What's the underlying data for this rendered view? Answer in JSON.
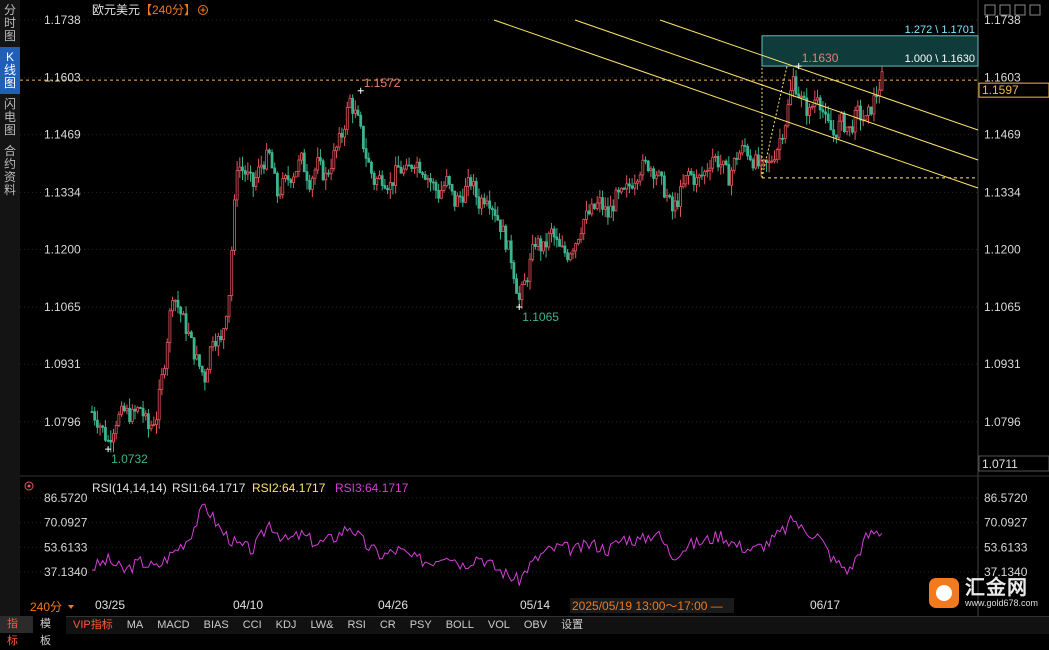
{
  "sidebar": {
    "tabs": [
      {
        "label": [
          "分",
          "时",
          "图"
        ],
        "active": false
      },
      {
        "label": [
          "K",
          "线",
          "图"
        ],
        "active": true
      },
      {
        "label": [
          "闪",
          "电",
          "图"
        ],
        "active": false
      },
      {
        "label": [
          "合",
          "约",
          "资",
          "料"
        ],
        "active": false
      }
    ]
  },
  "header": {
    "title": "欧元美元",
    "period": "【240分】",
    "settings_icon": "circle-plus-icon"
  },
  "toolbar_icons": [
    "move-icon",
    "zoom-out-icon",
    "zoom-in-icon",
    "fullscreen-icon"
  ],
  "colors": {
    "up": "#e9545b",
    "down": "#3bb58f",
    "rsi": "#d43fd8",
    "fib": "#ffe56a",
    "pivot_high": "#f07a7a",
    "pivot_low": "#3bb58f",
    "price_line": "#f4b44c"
  },
  "price_axis": [
    "1.1738",
    "1.1603",
    "1.1469",
    "1.1334",
    "1.1200",
    "1.1065",
    "1.0931",
    "1.0796"
  ],
  "current_price_tag": "1.1597",
  "low_price_tag": "1.0711",
  "annotations": {
    "high1": "1.1572",
    "low1": "1.0732",
    "low2": "1.1065",
    "high2": "1.1630",
    "fib_100": "1.000 \\ 1.1630",
    "fib_1272": "1.272 \\ 1.1701"
  },
  "rsi": {
    "header_label": "RSI(14,14,14)",
    "rsi1": "RSI1:64.1717",
    "rsi2": "RSI2:64.1717",
    "rsi3": "RSI3:64.1717",
    "axis": [
      "86.5720",
      "70.0927",
      "53.6133",
      "37.1340"
    ],
    "icon": "indicator-dot-icon"
  },
  "time_axis": [
    "03/25",
    "04/10",
    "04/26",
    "05/14",
    "06/17"
  ],
  "crosshair_time": "2025/05/19 13:00～17:00",
  "period_label": "240分",
  "bottom_left": [
    "指标",
    "模板"
  ],
  "bottom_tabs": [
    "VIP指标",
    "MA",
    "MACD",
    "BIAS",
    "CCI",
    "KDJ",
    "LW&",
    "RSI",
    "CR",
    "PSY",
    "BOLL",
    "VOL",
    "OBV",
    "设置"
  ],
  "logo": {
    "name": "汇金网",
    "url": "www.gold678.com"
  },
  "chart_data": {
    "type": "candlestick",
    "symbol": "EUR/USD",
    "timeframe": "240分",
    "x_ticks": [
      "03/25",
      "04/10",
      "04/26",
      "05/14",
      "06/17"
    ],
    "ylim": [
      1.0711,
      1.1738
    ],
    "pivots": [
      {
        "x": "03/25",
        "price": 1.0732,
        "kind": "low"
      },
      {
        "x": "04/21",
        "price": 1.1572,
        "kind": "high"
      },
      {
        "x": "05/12",
        "price": 1.1065,
        "kind": "low"
      },
      {
        "x": "06/12",
        "price": 1.163,
        "kind": "high"
      }
    ],
    "close_path": [
      [
        0,
        1.082
      ],
      [
        3,
        1.079
      ],
      [
        6,
        1.075
      ],
      [
        9,
        1.08
      ],
      [
        12,
        1.082
      ],
      [
        15,
        1.081
      ],
      [
        18,
        1.083
      ],
      [
        21,
        1.078
      ],
      [
        24,
        1.081
      ],
      [
        27,
        1.094
      ],
      [
        30,
        1.11
      ],
      [
        33,
        1.105
      ],
      [
        36,
        1.1
      ],
      [
        39,
        1.094
      ],
      [
        42,
        1.09
      ],
      [
        45,
        1.1
      ],
      [
        48,
        1.098
      ],
      [
        51,
        1.11
      ],
      [
        54,
        1.14
      ],
      [
        57,
        1.138
      ],
      [
        60,
        1.135
      ],
      [
        63,
        1.14
      ],
      [
        66,
        1.142
      ],
      [
        69,
        1.133
      ],
      [
        72,
        1.136
      ],
      [
        75,
        1.138
      ],
      [
        78,
        1.141
      ],
      [
        81,
        1.136
      ],
      [
        84,
        1.14
      ],
      [
        87,
        1.137
      ],
      [
        90,
        1.142
      ],
      [
        93,
        1.147
      ],
      [
        96,
        1.155
      ],
      [
        99,
        1.15
      ],
      [
        102,
        1.142
      ],
      [
        105,
        1.136
      ],
      [
        108,
        1.137
      ],
      [
        111,
        1.135
      ],
      [
        114,
        1.139
      ],
      [
        117,
        1.138
      ],
      [
        120,
        1.141
      ],
      [
        123,
        1.139
      ],
      [
        126,
        1.136
      ],
      [
        129,
        1.133
      ],
      [
        132,
        1.136
      ],
      [
        135,
        1.131
      ],
      [
        138,
        1.133
      ],
      [
        141,
        1.136
      ],
      [
        144,
        1.131
      ],
      [
        147,
        1.133
      ],
      [
        150,
        1.129
      ],
      [
        153,
        1.124
      ],
      [
        156,
        1.118
      ],
      [
        159,
        1.108
      ],
      [
        162,
        1.114
      ],
      [
        165,
        1.122
      ],
      [
        168,
        1.12
      ],
      [
        171,
        1.124
      ],
      [
        174,
        1.12
      ],
      [
        177,
        1.119
      ],
      [
        180,
        1.122
      ],
      [
        183,
        1.127
      ],
      [
        186,
        1.129
      ],
      [
        189,
        1.131
      ],
      [
        192,
        1.128
      ],
      [
        195,
        1.132
      ],
      [
        198,
        1.133
      ],
      [
        201,
        1.136
      ],
      [
        204,
        1.139
      ],
      [
        207,
        1.14
      ],
      [
        210,
        1.138
      ],
      [
        213,
        1.134
      ],
      [
        216,
        1.129
      ],
      [
        219,
        1.133
      ],
      [
        222,
        1.138
      ],
      [
        225,
        1.136
      ],
      [
        228,
        1.138
      ],
      [
        231,
        1.142
      ],
      [
        234,
        1.14
      ],
      [
        237,
        1.137
      ],
      [
        240,
        1.142
      ],
      [
        243,
        1.144
      ],
      [
        246,
        1.141
      ],
      [
        249,
        1.139
      ],
      [
        252,
        1.14
      ],
      [
        255,
        1.144
      ],
      [
        258,
        1.15
      ],
      [
        261,
        1.16
      ],
      [
        264,
        1.155
      ],
      [
        267,
        1.152
      ],
      [
        270,
        1.157
      ],
      [
        273,
        1.15
      ],
      [
        276,
        1.147
      ],
      [
        279,
        1.15
      ],
      [
        282,
        1.148
      ],
      [
        285,
        1.152
      ],
      [
        288,
        1.15
      ],
      [
        291,
        1.155
      ],
      [
        294,
        1.16
      ]
    ],
    "fib_levels": [
      {
        "ratio": 1.0,
        "price": 1.163
      },
      {
        "ratio": 1.272,
        "price": 1.1701
      }
    ],
    "rsi_path": [
      [
        0,
        40
      ],
      [
        6,
        45
      ],
      [
        12,
        38
      ],
      [
        18,
        44
      ],
      [
        24,
        40
      ],
      [
        30,
        50
      ],
      [
        36,
        60
      ],
      [
        42,
        82
      ],
      [
        48,
        65
      ],
      [
        54,
        55
      ],
      [
        60,
        52
      ],
      [
        66,
        70
      ],
      [
        72,
        58
      ],
      [
        78,
        62
      ],
      [
        84,
        56
      ],
      [
        90,
        60
      ],
      [
        96,
        68
      ],
      [
        102,
        55
      ],
      [
        108,
        48
      ],
      [
        114,
        52
      ],
      [
        120,
        46
      ],
      [
        126,
        44
      ],
      [
        132,
        50
      ],
      [
        138,
        42
      ],
      [
        144,
        48
      ],
      [
        150,
        40
      ],
      [
        156,
        34
      ],
      [
        159,
        31
      ],
      [
        162,
        40
      ],
      [
        168,
        50
      ],
      [
        174,
        54
      ],
      [
        180,
        52
      ],
      [
        186,
        56
      ],
      [
        192,
        52
      ],
      [
        198,
        60
      ],
      [
        204,
        58
      ],
      [
        210,
        64
      ],
      [
        216,
        48
      ],
      [
        222,
        55
      ],
      [
        228,
        58
      ],
      [
        234,
        62
      ],
      [
        240,
        55
      ],
      [
        246,
        52
      ],
      [
        252,
        57
      ],
      [
        258,
        66
      ],
      [
        261,
        73
      ],
      [
        264,
        66
      ],
      [
        270,
        62
      ],
      [
        276,
        45
      ],
      [
        282,
        38
      ],
      [
        288,
        60
      ],
      [
        291,
        64
      ],
      [
        294,
        64
      ]
    ]
  }
}
